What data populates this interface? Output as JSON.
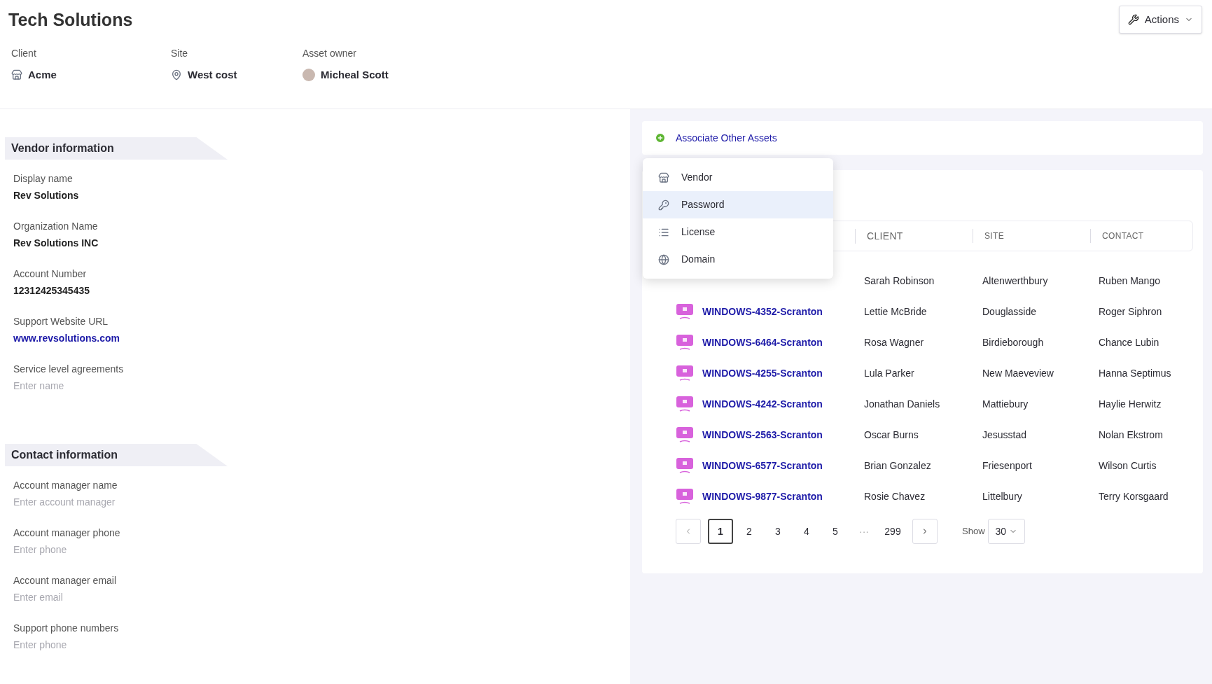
{
  "header": {
    "title": "Tech Solutions",
    "actions_button": "Actions",
    "meta": [
      {
        "kind": "client",
        "label": "Client",
        "value": "Acme"
      },
      {
        "kind": "site",
        "label": "Site",
        "value": "West cost"
      },
      {
        "kind": "owner",
        "label": "Asset owner",
        "value": "Micheal Scott"
      }
    ]
  },
  "sections": [
    {
      "title": "Vendor information",
      "fields": [
        {
          "label": "Display name",
          "value": "Rev Solutions"
        },
        {
          "label": "Organization Name",
          "value": "Rev Solutions INC"
        },
        {
          "label": "Account Number",
          "value": "12312425345435"
        },
        {
          "label": "Support Website URL",
          "value": "www.revsolutions.com",
          "kind": "link"
        },
        {
          "label": "Service level agreements",
          "placeholder": "Enter name"
        }
      ]
    },
    {
      "title": "Contact information",
      "fields": [
        {
          "label": "Account manager name",
          "placeholder": "Enter account manager"
        },
        {
          "label": "Account manager phone",
          "placeholder": "Enter phone"
        },
        {
          "label": "Account manager email",
          "placeholder": "Enter email"
        },
        {
          "label": "Support phone numbers",
          "placeholder": "Enter phone"
        }
      ]
    }
  ],
  "associate": {
    "label": "Associate Other Assets",
    "menu": [
      {
        "kind": "vendor",
        "label": "Vendor",
        "selected": false
      },
      {
        "kind": "password",
        "label": "Password",
        "selected": true
      },
      {
        "kind": "license",
        "label": "License",
        "selected": false
      },
      {
        "kind": "domain",
        "label": "Domain",
        "selected": false
      }
    ]
  },
  "table": {
    "columns": [
      "CLIENT",
      "SITE",
      "CONTACT"
    ],
    "rows": [
      {
        "client": "Sarah Robinson",
        "site": "Altenwerthbury",
        "contact": "Ruben Mango"
      },
      {
        "asset": "WINDOWS-4352-Scranton",
        "client": "Lettie McBride",
        "site": "Douglasside",
        "contact": "Roger Siphron"
      },
      {
        "asset": "WINDOWS-6464-Scranton",
        "client": "Rosa Wagner",
        "site": "Birdieborough",
        "contact": "Chance Lubin"
      },
      {
        "asset": "WINDOWS-4255-Scranton",
        "client": "Lula Parker",
        "site": "New Maeveview",
        "contact": "Hanna Septimus"
      },
      {
        "asset": "WINDOWS-4242-Scranton",
        "client": "Jonathan Daniels",
        "site": "Mattiebury",
        "contact": "Haylie Herwitz"
      },
      {
        "asset": "WINDOWS-2563-Scranton",
        "client": "Oscar Burns",
        "site": "Jesusstad",
        "contact": "Nolan Ekstrom"
      },
      {
        "asset": "WINDOWS-6577-Scranton",
        "client": "Brian Gonzalez",
        "site": "Friesenport",
        "contact": "Wilson Curtis"
      },
      {
        "asset": "WINDOWS-9877-Scranton",
        "client": "Rosie Chavez",
        "site": "Littelbury",
        "contact": "Terry Korsgaard"
      }
    ]
  },
  "pagination": {
    "pages": [
      {
        "label": "1",
        "selected": true
      },
      {
        "label": "2",
        "selected": false
      },
      {
        "label": "3",
        "selected": false
      },
      {
        "label": "4",
        "selected": false
      },
      {
        "label": "5",
        "selected": false
      },
      {
        "label": "···",
        "kind": "ellipsis"
      },
      {
        "label": "299",
        "selected": false
      }
    ],
    "show_label": "Show",
    "page_size": "30"
  }
}
